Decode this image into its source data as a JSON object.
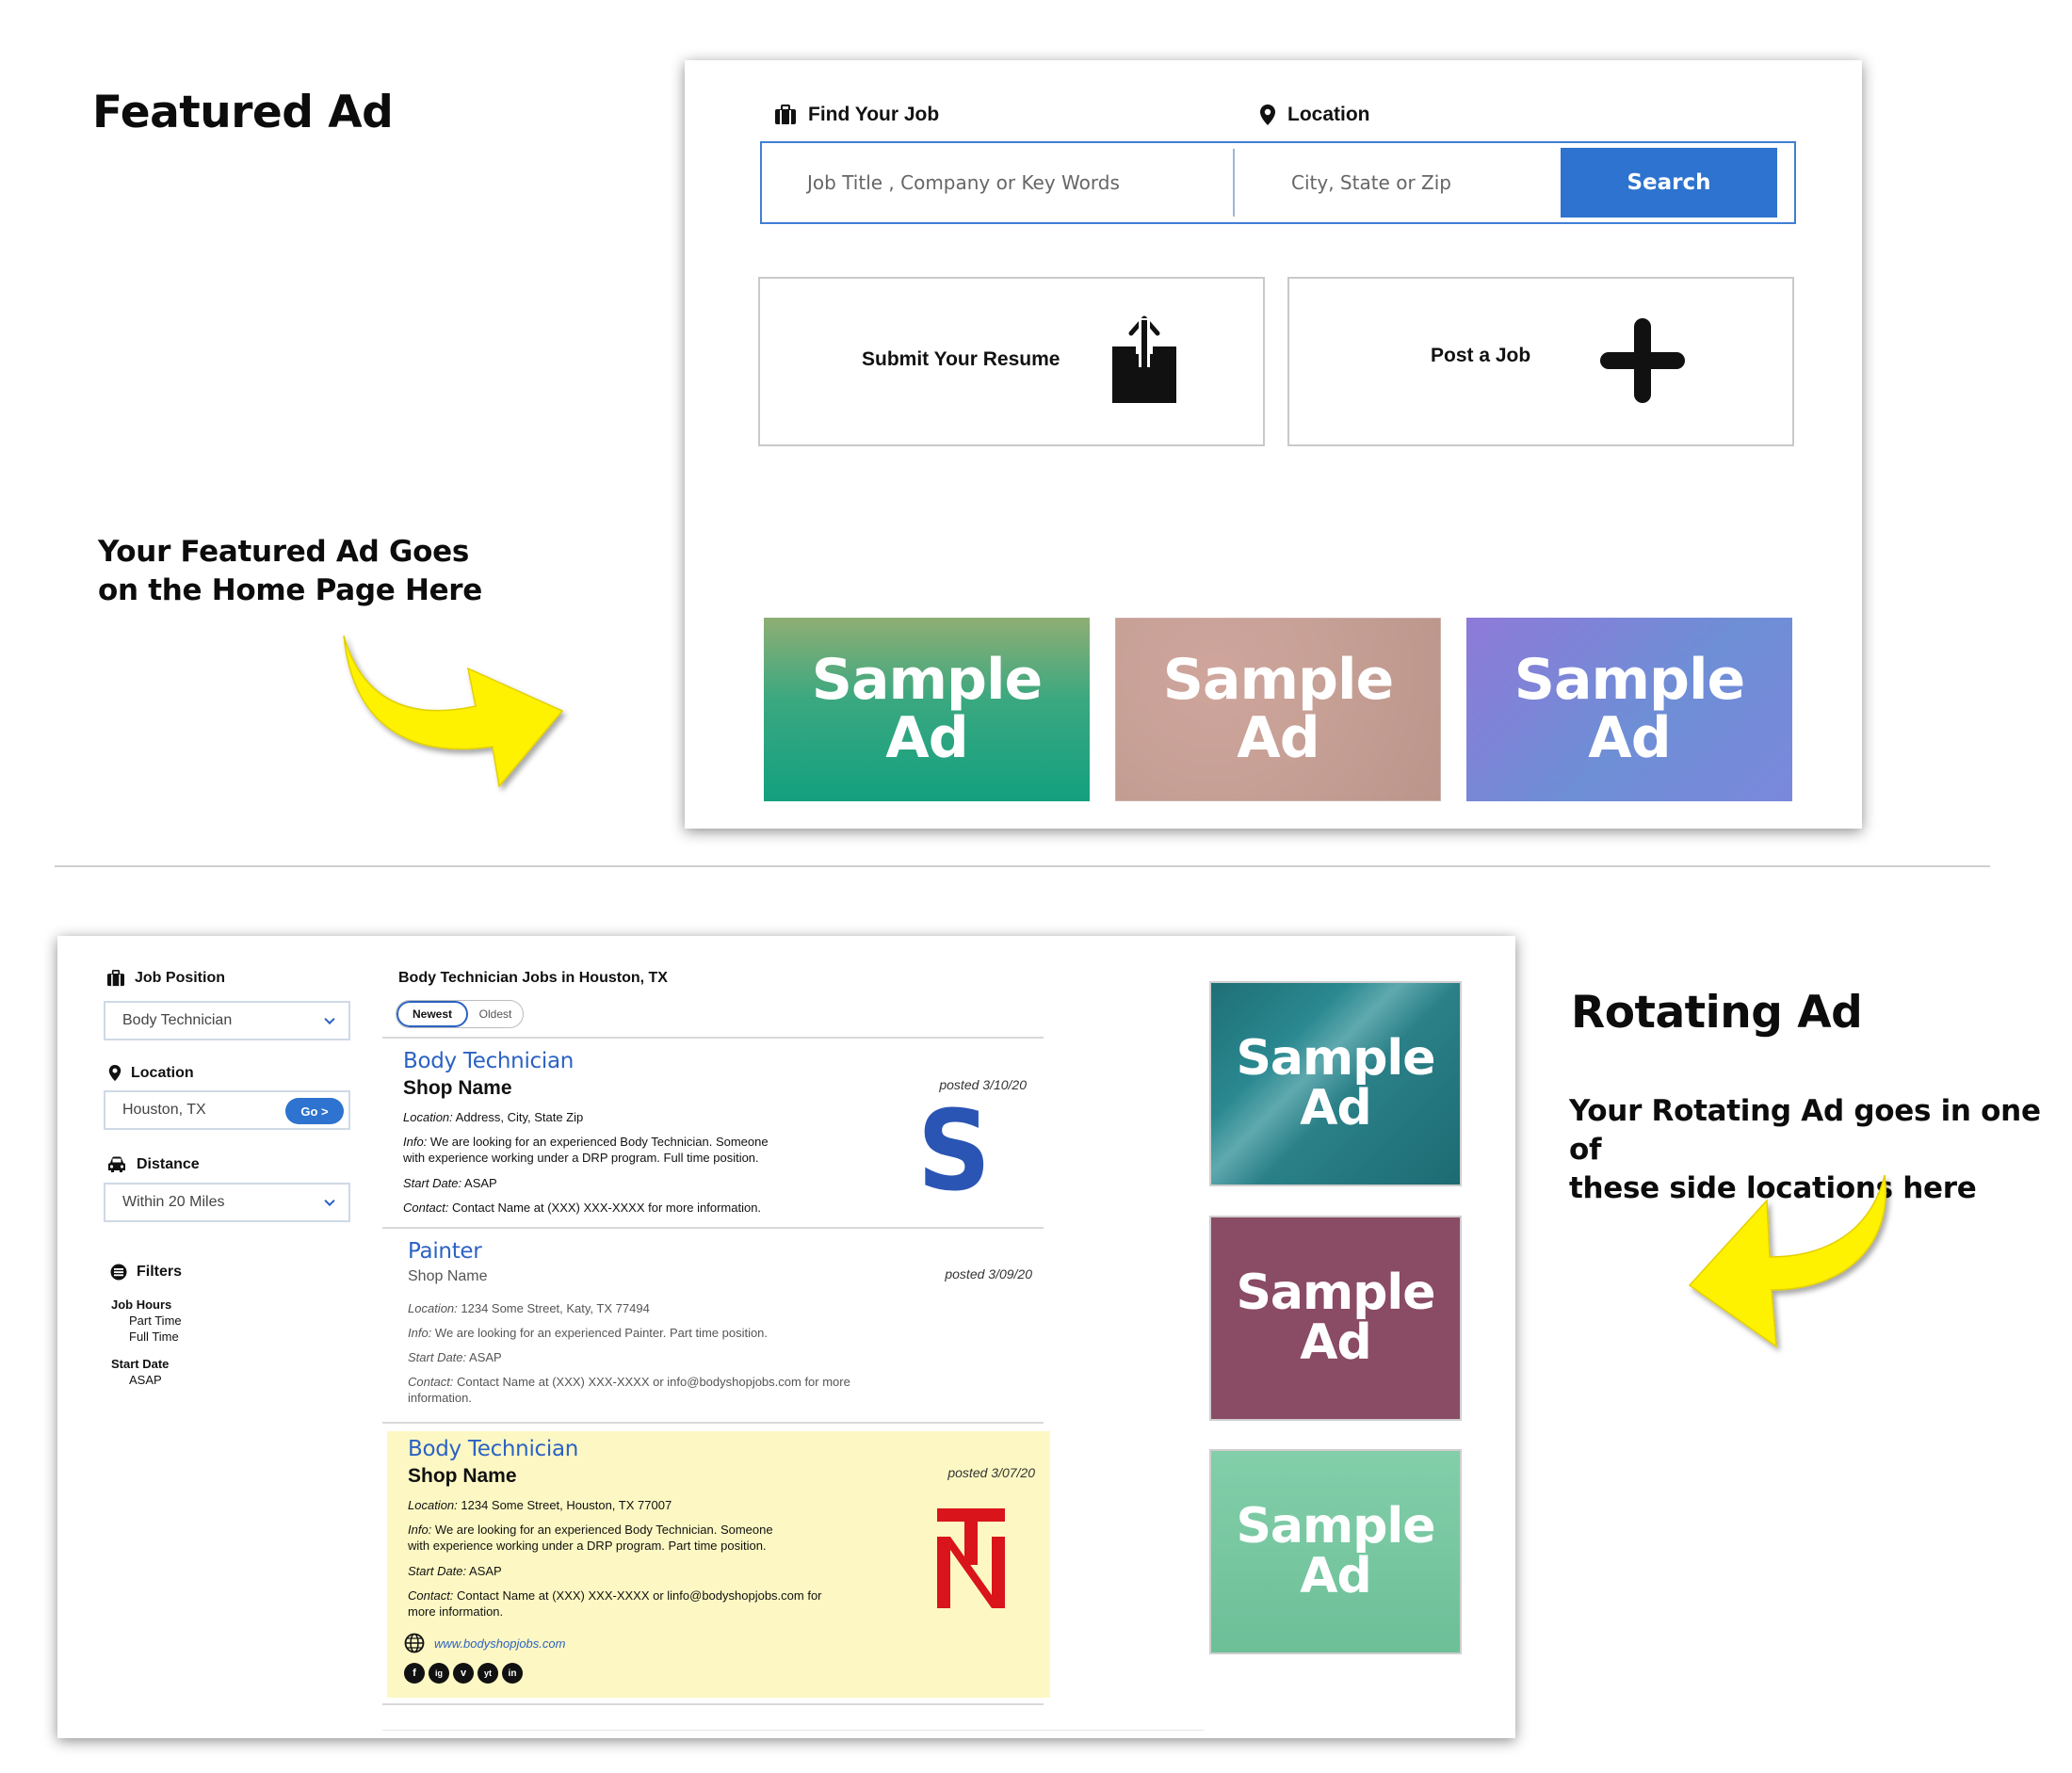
{
  "featured_section": {
    "heading": "Featured Ad",
    "note_line1": "Your Featured Ad Goes",
    "note_line2": "on the Home Page Here"
  },
  "rotating_section": {
    "heading": "Rotating Ad",
    "note_line1": "Your Rotating Ad goes in one of",
    "note_line2": "these side locations here"
  },
  "home_search": {
    "find_label": "Find Your Job",
    "location_label": "Location",
    "job_placeholder": "Job Title , Company or Key Words",
    "location_placeholder": "City, State or Zip",
    "search_button": "Search"
  },
  "home_actions": {
    "submit_resume": "Submit Your Resume",
    "post_job": "Post a Job"
  },
  "featured_ads": [
    {
      "line1": "Sample",
      "line2": "Ad"
    },
    {
      "line1": "Sample",
      "line2": "Ad"
    },
    {
      "line1": "Sample",
      "line2": "Ad"
    }
  ],
  "side_ads": [
    {
      "line1": "Sample",
      "line2": "Ad"
    },
    {
      "line1": "Sample",
      "line2": "Ad"
    },
    {
      "line1": "Sample",
      "line2": "Ad"
    }
  ],
  "sidebar": {
    "job_position_label": "Job Position",
    "job_position_value": "Body Technician",
    "location_label": "Location",
    "location_value": "Houston, TX",
    "go_button": "Go >",
    "distance_label": "Distance",
    "distance_value": "Within 20 Miles",
    "filters_label": "Filters",
    "job_hours_label": "Job Hours",
    "job_hours_options": [
      "Part Time",
      "Full Time"
    ],
    "start_date_label": "Start Date",
    "start_date_options": [
      "ASAP"
    ]
  },
  "results": {
    "title": "Body Technician Jobs in Houston, TX",
    "sort_newest": "Newest",
    "sort_oldest": "Oldest",
    "jobs": [
      {
        "title": "Body Technician",
        "shop": "Shop Name",
        "posted": "posted 3/10/20",
        "location_label": "Location:",
        "location": " Address, City, State Zip",
        "info_label": "Info:",
        "info_line1": " We are looking for an experienced Body Technician. Someone",
        "info_line2": "with experience working under a DRP program. Full time position.",
        "start_label": "Start Date:",
        "start": " ASAP",
        "contact_label": "Contact:",
        "contact": " Contact Name at (XXX) XXX-XXXX for more information.",
        "logo_letter": "S"
      },
      {
        "title": "Painter",
        "shop": "Shop Name",
        "posted": "posted 3/09/20",
        "location_label": "Location:",
        "location": " 1234 Some Street, Katy, TX 77494",
        "info_label": "Info:",
        "info_line1": " We are looking for an experienced Painter. Part time position.",
        "start_label": "Start Date:",
        "start": " ASAP",
        "contact_label": "Contact:",
        "contact_line1": " Contact Name at (XXX) XXX-XXXX or info@bodyshopjobs.com for more",
        "contact_line2": "information."
      },
      {
        "title": "Body Technician",
        "shop": "Shop Name",
        "posted": "posted 3/07/20",
        "location_label": "Location:",
        "location": " 1234 Some Street, Houston, TX 77007",
        "info_label": "Info:",
        "info_line1": " We are looking for an experienced Body Technician. Someone",
        "info_line2": "with experience working under a DRP program. Part time position.",
        "start_label": "Start Date:",
        "start": " ASAP",
        "contact_label": "Contact:",
        "contact_line1": "  Contact Name at (XXX) XXX-XXXX or linfo@bodyshopjobs.com for",
        "contact_line2": "more information.",
        "website": "www.bodyshopjobs.com",
        "logo_letters": "TN",
        "social_icons": [
          "f",
          "ig",
          "v",
          "yt",
          "in"
        ]
      }
    ]
  },
  "colors": {
    "accent_blue": "#2d73cf",
    "link_blue": "#2b62c4",
    "highlight_yellow": "#fdf8c3",
    "arrow_yellow": "#fff200",
    "logo_s_blue": "#2a55b4",
    "logo_tn_red": "#d9141b"
  }
}
